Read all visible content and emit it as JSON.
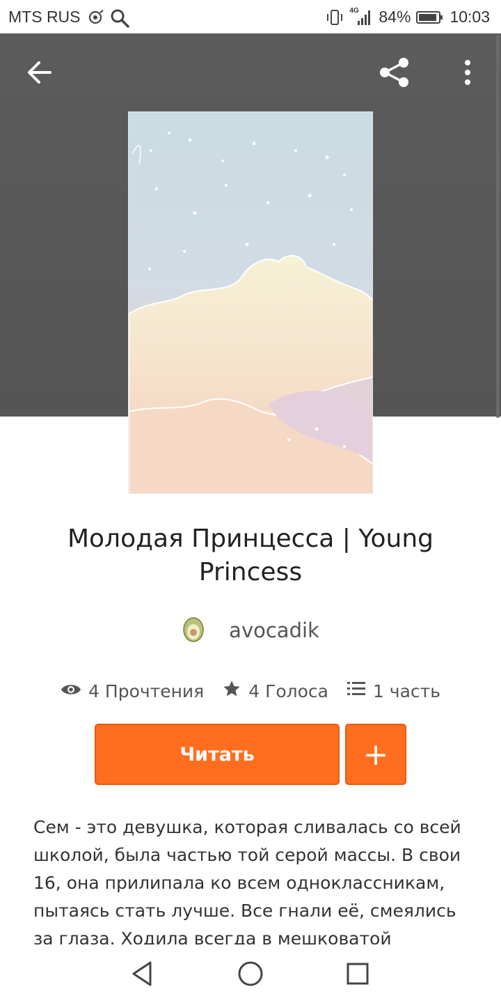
{
  "status_bar": {
    "carrier": "MTS RUS",
    "network": "4G",
    "battery": "84%",
    "time": "10:03",
    "icons": [
      "hotspot-icon",
      "search-icon",
      "vibrate-icon",
      "signal-icon",
      "battery-icon"
    ]
  },
  "toolbar": {
    "back_icon": "arrow-left-icon",
    "share_icon": "share-icon",
    "more_icon": "more-vert-icon"
  },
  "story": {
    "title": "Молодая Принцесса | Young Princess",
    "author": "avocadik",
    "stats": {
      "reads": "4 Прочтения",
      "votes": "4 Голоса",
      "parts": "1 часть"
    },
    "read_button": "Читать",
    "add_button": "+",
    "description": "Сем - это девушка, которая сливалась со всей школой, была частью той серой массы. В свои 16, она прилипала ко всем одноклассникам, пытаясь стать лучше. Все гнали её, смеялись за глаза. Ходила всегда в мешковатой одежде."
  },
  "colors": {
    "accent": "#ff6e1f",
    "hero_bg": "#575757"
  }
}
